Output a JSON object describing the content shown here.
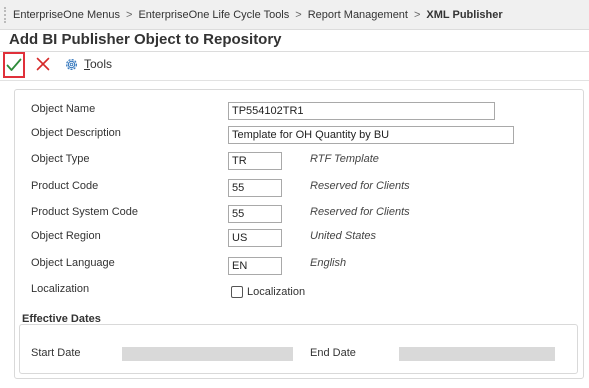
{
  "breadcrumb": {
    "items": [
      "EnterpriseOne Menus",
      "EnterpriseOne Life Cycle Tools",
      "Report Management",
      "XML Publisher"
    ],
    "separator": ">"
  },
  "page": {
    "title": "Add BI Publisher Object to Repository"
  },
  "toolbar": {
    "ok_icon": "checkmark-icon",
    "cancel_icon": "close-icon",
    "tools_icon": "gear-icon",
    "tools_label_mnemonic": "T",
    "tools_label_rest": "ools"
  },
  "form": {
    "object_name": {
      "label": "Object Name",
      "value": "TP554102TR1"
    },
    "object_description": {
      "label": "Object Description",
      "value": "Template for OH Quantity by BU"
    },
    "object_type": {
      "label": "Object Type",
      "value": "TR",
      "description": "RTF Template"
    },
    "product_code": {
      "label": "Product Code",
      "value": "55",
      "description": "Reserved for Clients"
    },
    "product_system_code": {
      "label": "Product System Code",
      "value": "55",
      "description": "Reserved for Clients"
    },
    "object_region": {
      "label": "Object Region",
      "value": "US",
      "description": "United States"
    },
    "object_language": {
      "label": "Object Language",
      "value": "EN",
      "description": "English"
    },
    "localization": {
      "label": "Localization",
      "checkbox_label": "Localization",
      "checked": false
    }
  },
  "effective_dates": {
    "heading": "Effective Dates",
    "start_label": "Start Date",
    "start_value": "",
    "end_label": "End Date",
    "end_value": ""
  },
  "colors": {
    "accent_check": "#2e8b3a",
    "cancel_red": "#d62a2a",
    "focus_border": "#e0303a",
    "gear_blue": "#3a7bbf"
  }
}
